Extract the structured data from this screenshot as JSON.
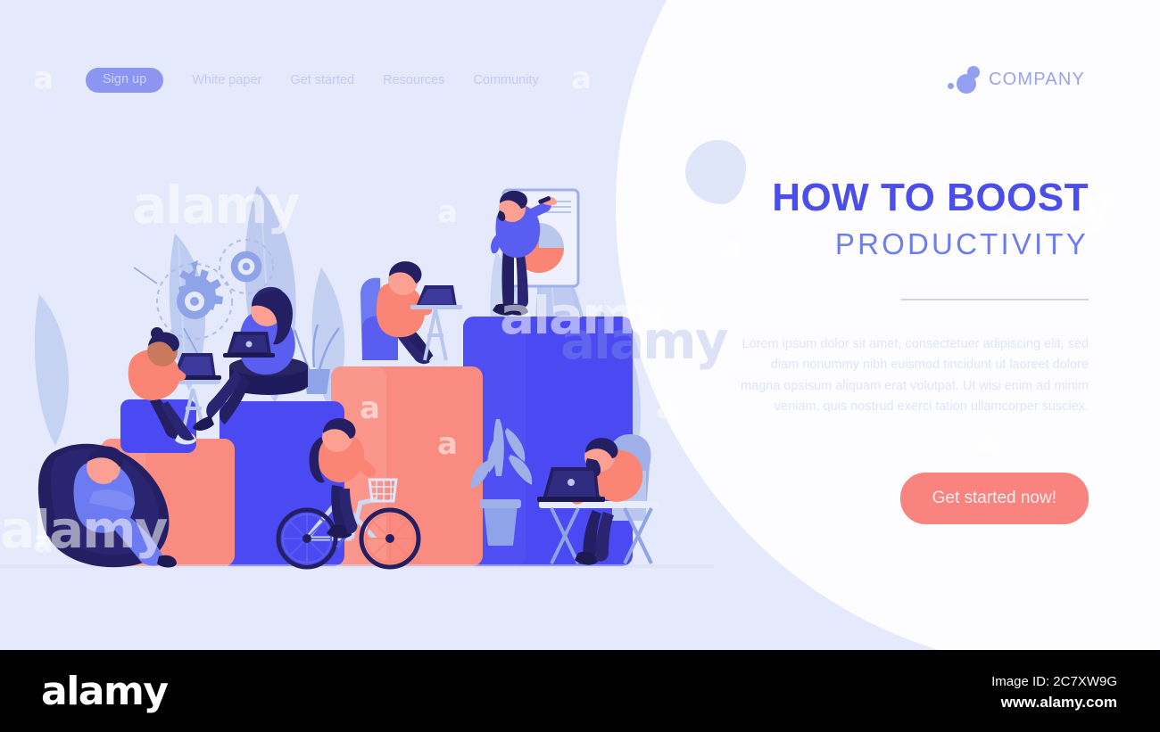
{
  "nav": {
    "signup_label": "Sign up",
    "links": [
      {
        "label": "White paper"
      },
      {
        "label": "Get started"
      },
      {
        "label": "Resources"
      },
      {
        "label": "Community"
      }
    ]
  },
  "brand": {
    "name": "COMPANY",
    "mark": "two-circles-dot-logo",
    "color": "#93a0f2"
  },
  "hero": {
    "headline": "HOW TO BOOST",
    "subhead": "PRODUCTIVITY",
    "body": "Lorem ipsum dolor sit amet, consectetuer adipiscing elit, sed diam nonummy nibh euismod tincidunt ut laoreet dolore magna opsisum aliquam erat volutpat. Ut wisi enim ad minim veniam, quis nostrud exerci tation ullamcorper susciex.",
    "cta_label": "Get started now!",
    "headline_color": "#4b4ee8",
    "subhead_color": "#6d7df0",
    "cta_color": "#f9837f"
  },
  "illustration": {
    "description": "Flat vector of people working on ascending blocks / steps",
    "background_color": "#e4e9fb",
    "block_colors": [
      "#f98b80",
      "#4a49f2"
    ],
    "accent_blue": "#4a49f2",
    "accent_coral": "#f98b80",
    "elements": [
      "leaf-shapes",
      "gear-icons",
      "beanbag-person-with-phone",
      "person-on-cube-with-laptop",
      "woman-on-stool-with-laptop",
      "potted-plant",
      "woman-on-bicycle",
      "man-in-armchair-with-laptop",
      "man-drawing-pie-chart-on-flipchart",
      "man-at-desk-with-laptop-in-armchair"
    ]
  },
  "watermarks": {
    "brand": "alamy",
    "letter": "a"
  },
  "footer": {
    "logo": "alamy",
    "image_id_label": "Image ID: 2C7XW9G",
    "website": "www.alamy.com",
    "background": "#000000"
  }
}
